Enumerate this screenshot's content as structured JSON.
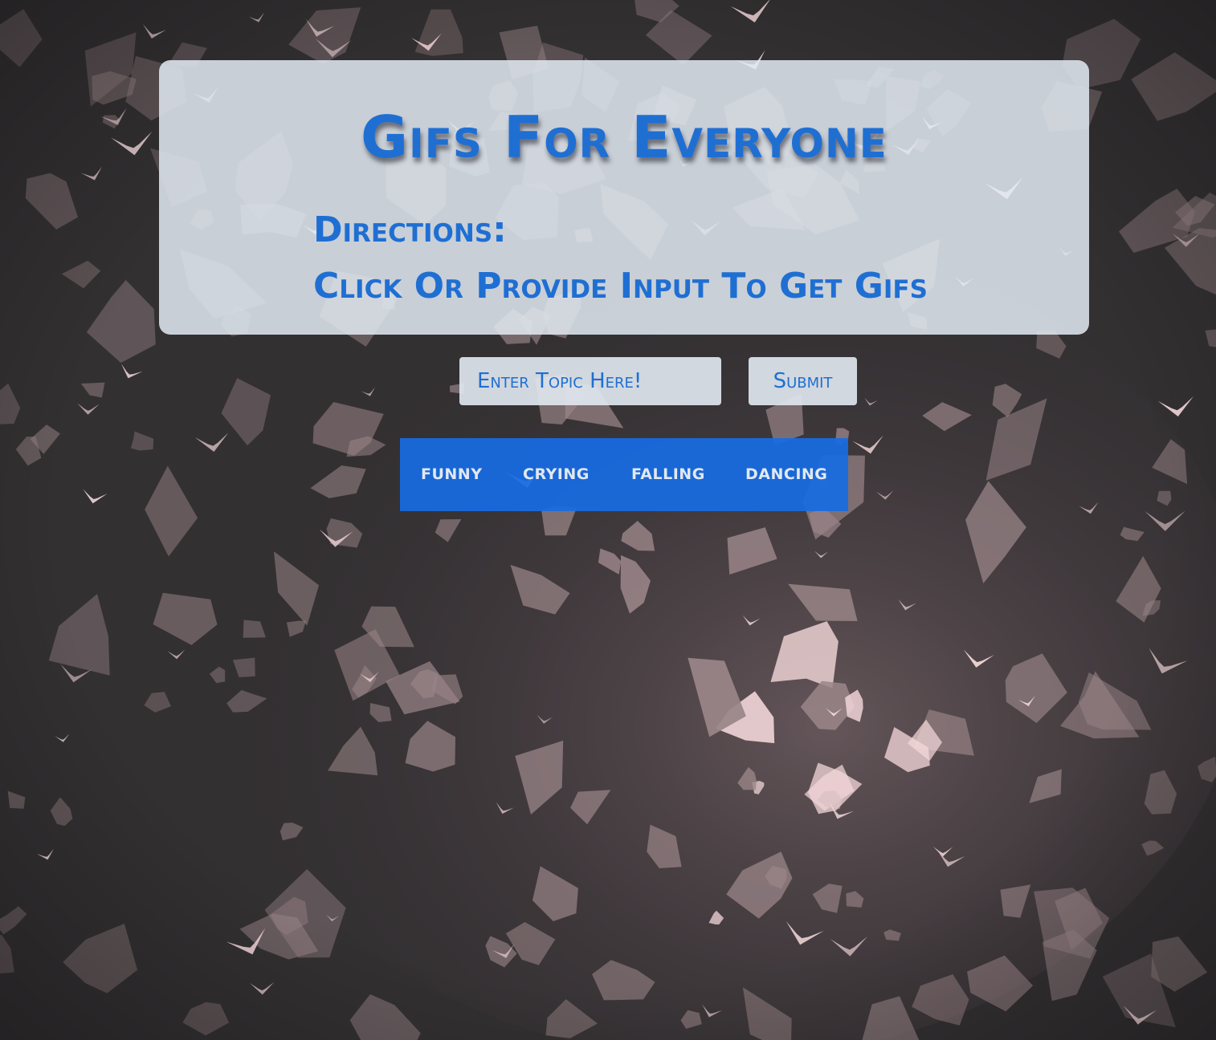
{
  "page": {
    "title": "Gifs For Everyone",
    "directions_heading": "Directions:",
    "directions_text": "Click Or Provide Input To Get Gifs"
  },
  "search": {
    "placeholder": "Enter Topic Here!",
    "submit_label": "Submit"
  },
  "topics": [
    "FUNNY",
    "CRYING",
    "FALLING",
    "DANCING"
  ],
  "background": {
    "description_icon": "origami-butterflies-background",
    "base_color": "#333032",
    "shape_color": "#9a8588",
    "glow_color": "#f4d8da"
  },
  "colors": {
    "accent": "#1f6fd3",
    "topic_bar": "#176ce2",
    "panel": "#e2eaf2"
  }
}
